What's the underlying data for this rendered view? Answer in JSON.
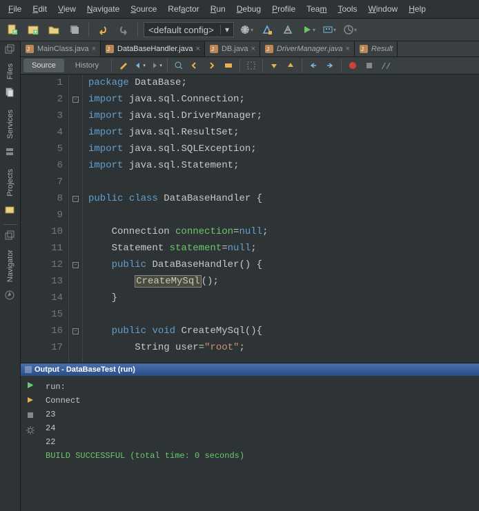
{
  "menu": {
    "file": "File",
    "edit": "Edit",
    "view": "View",
    "navigate": "Navigate",
    "source": "Source",
    "refactor": "Refactor",
    "run": "Run",
    "debug": "Debug",
    "profile": "Profile",
    "team": "Team",
    "tools": "Tools",
    "window": "Window",
    "help": "Help"
  },
  "toolbar": {
    "config_value": "<default config>"
  },
  "sidebar": {
    "files": "Files",
    "services": "Services",
    "projects": "Projects",
    "navigator": "Navigator"
  },
  "tabs": [
    {
      "label": "MainClass.java",
      "active": false
    },
    {
      "label": "DataBaseHandler.java",
      "active": true
    },
    {
      "label": "DB.java",
      "active": false
    },
    {
      "label": "DriverManager.java",
      "active": false,
      "italic": true
    },
    {
      "label": "Result",
      "active": false,
      "italic": true
    }
  ],
  "editor_tabs": {
    "source": "Source",
    "history": "History"
  },
  "code": {
    "lines": [
      {
        "n": 1,
        "text": "package DataBase;"
      },
      {
        "n": 2,
        "text": "import java.sql.Connection;"
      },
      {
        "n": 3,
        "text": "import java.sql.DriverManager;"
      },
      {
        "n": 4,
        "text": "import java.sql.ResultSet;"
      },
      {
        "n": 5,
        "text": "import java.sql.SQLException;"
      },
      {
        "n": 6,
        "text": "import java.sql.Statement;"
      },
      {
        "n": 7,
        "text": ""
      },
      {
        "n": 8,
        "text": "public class DataBaseHandler {"
      },
      {
        "n": 9,
        "text": ""
      },
      {
        "n": 10,
        "text": "    Connection connection=null;"
      },
      {
        "n": 11,
        "text": "    Statement statement=null;"
      },
      {
        "n": 12,
        "text": "    public DataBaseHandler() {"
      },
      {
        "n": 13,
        "text": "        CreateMySql();"
      },
      {
        "n": 14,
        "text": "    }"
      },
      {
        "n": 15,
        "text": ""
      },
      {
        "n": 16,
        "text": "    public void CreateMySql(){"
      },
      {
        "n": 17,
        "text": "        String user=\"root\";"
      }
    ]
  },
  "output": {
    "title": "Output - DataBaseTest (run)",
    "lines": [
      "run:",
      "Connect",
      "23",
      "24",
      "22"
    ],
    "success": "BUILD SUCCESSFUL (total time: 0 seconds)"
  }
}
